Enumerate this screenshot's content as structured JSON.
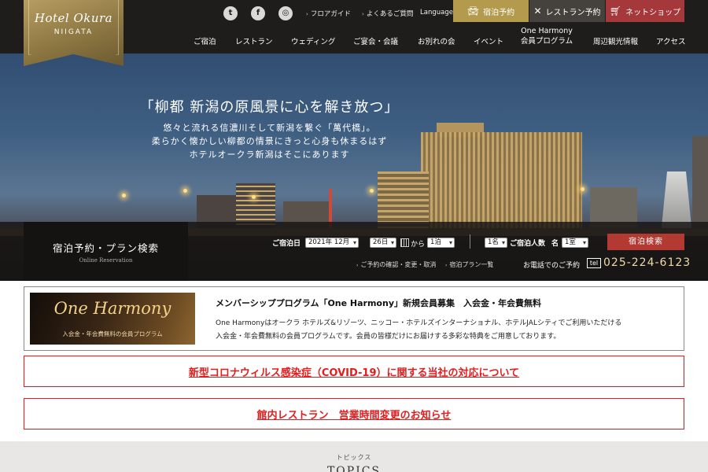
{
  "logo": {
    "script": "Hotel Okura",
    "sub": "NIIGATA"
  },
  "social": [
    {
      "name": "twitter-icon",
      "glyph": "t"
    },
    {
      "name": "facebook-icon",
      "glyph": "f"
    },
    {
      "name": "instagram-icon",
      "glyph": "◎"
    }
  ],
  "utility": {
    "floor_guide": "フロアガイド",
    "faq": "よくあるご質問",
    "language": "Language"
  },
  "top_buttons": {
    "stay": "宿泊予約",
    "restaurant": "レストラン予約",
    "shop": "ネットショップ"
  },
  "nav": {
    "rooms": "ご宿泊",
    "restaurant": "レストラン",
    "wedding": "ウェディング",
    "banquet": "ご宴会・会議",
    "farewell": "お別れの会",
    "event": "イベント",
    "member_line1": "One Harmony",
    "member_line2": "会員プログラム",
    "sightseeing": "周辺観光情報",
    "access": "アクセス"
  },
  "hero": {
    "headline": "「柳都 新潟の原風景に心を解き放つ」",
    "line1": "悠々と流れる信濃川そして新潟を繋ぐ「萬代橋」。",
    "line2": "柔らかく懐かしい柳都の情景にきっと心身も休まるはず",
    "line3": "ホテルオークラ新潟はそこにあります"
  },
  "reservation": {
    "title": "宿泊予約・プラン検索",
    "subtitle": "Online Reservation",
    "checkin_label": "ご宿泊日",
    "month_value": "2021年 12月",
    "day_value": "26日",
    "from_text": "から",
    "nights_value": "1泊",
    "guests_value": "1名",
    "guests_label": "ご宿泊人数",
    "name_text": "名",
    "rooms_value": "1室",
    "search_button": "宿泊検索",
    "confirm_link": "ご予約の確認・変更・取消",
    "plans_link": "宿泊プラン一覧",
    "phone_label": "お電話でのご予約",
    "tel_badge": "tel",
    "phone_number": "025-224-6123"
  },
  "member": {
    "banner_title": "One Harmony",
    "banner_sub": "入会金・年会費無料の会員プログラム",
    "title": "メンバーシッププログラム「One Harmony」新規会員募集　入会金・年会費無料",
    "desc1": "One Harmonyはオークラ ホテルズ&リゾーツ、ニッコー・ホテルズインターナショナル、ホテルJALシティでご利用いただける",
    "desc2": "入会金・年会費無料の会員プログラムです。会員の皆様だけにお届けする多彩な特典をご用意しております。"
  },
  "notices": {
    "covid": "新型コロナウィルス感染症（COVID-19）に関する当社の対応について",
    "restaurant": "館内レストラン　営業時間変更のお知らせ"
  },
  "topics": {
    "kana": "トピックス",
    "title": "TOPICS"
  },
  "colors": {
    "header_bg": "#1f1d1c",
    "gold": "#a08a4f",
    "stay_btn": "#b39a4c",
    "restaurant_btn": "#45413d",
    "shop_btn": "#a5383a",
    "search_btn": "#b33a33",
    "notice_red": "#e31d1d"
  }
}
